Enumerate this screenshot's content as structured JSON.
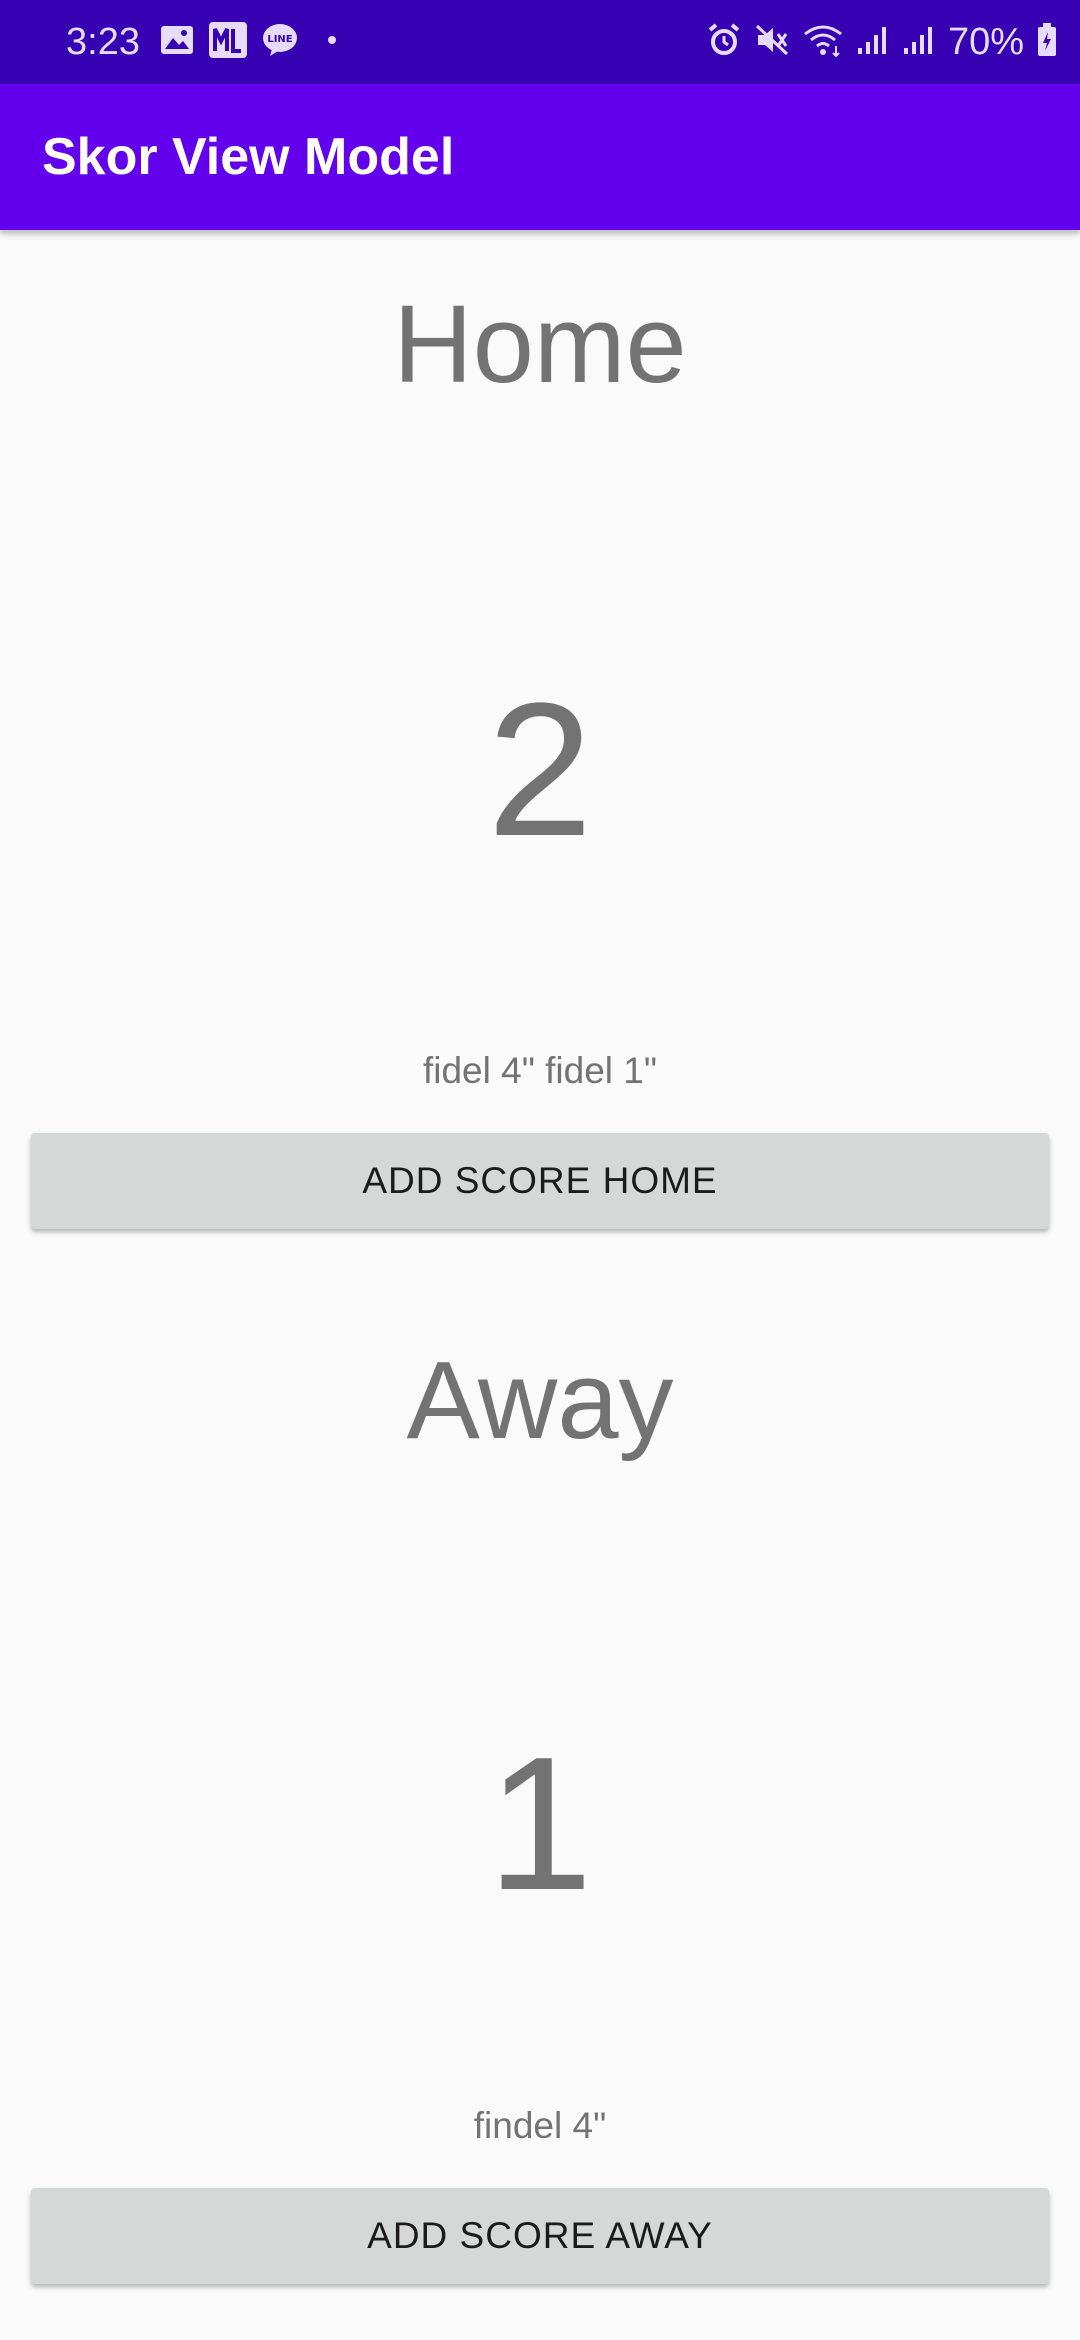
{
  "status_bar": {
    "time": "3:23",
    "battery": "70%",
    "icons": [
      "gallery-icon",
      "ml-app-icon",
      "line-app-icon",
      "notification-dot-icon",
      "alarm-icon",
      "mute-icon",
      "wifi-icon",
      "signal-icon",
      "signal-icon-2",
      "battery-icon"
    ]
  },
  "app_bar": {
    "title": "Skor View Model"
  },
  "home": {
    "label": "Home",
    "score": "2",
    "scorers": "fidel 4\" fidel 1\"",
    "button_label": "ADD SCORE HOME"
  },
  "away": {
    "label": "Away",
    "score": "1",
    "scorers": "findel 4\"",
    "button_label": "ADD SCORE AWAY"
  },
  "colors": {
    "status_bar": "#3700b3",
    "app_bar": "#6200ee",
    "background": "#fafafa",
    "button": "#d6d7d7",
    "text_gray": "#737373"
  }
}
